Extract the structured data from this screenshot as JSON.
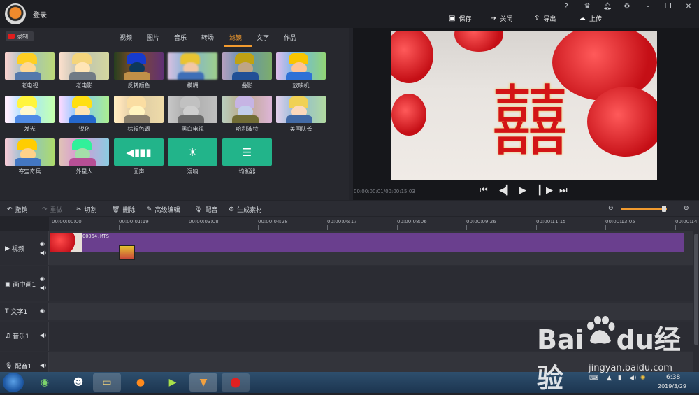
{
  "titlebar": {
    "login": "登录",
    "actions": {
      "save": "保存",
      "close": "关闭",
      "export": "导出",
      "upload": "上传"
    }
  },
  "record_label": "录制",
  "media_tabs": [
    "视频",
    "图片",
    "音乐",
    "转场",
    "滤镜",
    "文字",
    "作品"
  ],
  "active_tab": "滤镜",
  "filters": [
    "老电视",
    "老电影",
    "反转颜色",
    "模糊",
    "叠影",
    "放映机",
    "发光",
    "锐化",
    "棕褐色调",
    "黑白电视",
    "哈利波特",
    "美国队长",
    "夺宝奇兵",
    "外星人",
    "回声",
    "混响",
    "均衡器"
  ],
  "preview": {
    "time": "00:00:00:01/00:00:15:03",
    "video_text": "囍"
  },
  "toolbar": {
    "undo": "撤销",
    "redo": "重做",
    "cut": "切割",
    "delete": "删除",
    "advanced_edit": "高级编辑",
    "dub": "配音",
    "generate": "生成素材"
  },
  "ruler_ticks": [
    "00:00:00:00",
    "00:00:01:19",
    "00:00:03:08",
    "00:00:04:28",
    "00:00:06:17",
    "00:00:08:06",
    "00:00:09:26",
    "00:00:11:15",
    "00:00:13:05",
    "00:00:14:"
  ],
  "tracks": [
    "视频",
    "画中画1",
    "文字1",
    "音乐1",
    "配音1"
  ],
  "clip_name": "00064.MTS",
  "tray": {
    "time": "6:38",
    "date": "2019/3/29"
  },
  "watermark": {
    "brand": "Bai",
    "brand2": "du",
    "cn": "经验",
    "url": "jingyan.baidu.com"
  },
  "colors": {
    "accent": "#f29b2f",
    "clip": "#6a3f8e",
    "audio_filter": "#22b48a"
  }
}
